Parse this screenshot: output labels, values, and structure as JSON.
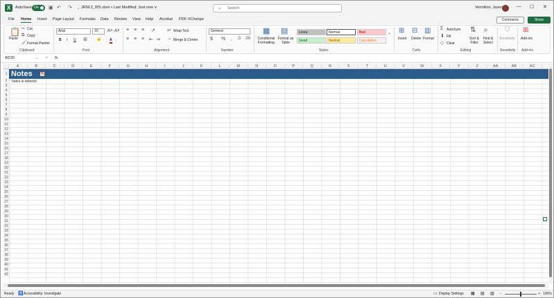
{
  "title_bar": {
    "autosave_label": "AutoSave",
    "autosave_state": "On",
    "document_title": "JRNL2_WS.xlsm • Last Modified: Just now ∨",
    "search_placeholder": "Search",
    "user_name": "Vermilion, Jason"
  },
  "menu": {
    "tabs": [
      "File",
      "Home",
      "Insert",
      "Page Layout",
      "Formulas",
      "Data",
      "Review",
      "View",
      "Help",
      "Acrobat",
      "PDF-XChange"
    ],
    "active_tab": "Home",
    "comments_label": "Comments",
    "share_label": "Share"
  },
  "ribbon": {
    "clipboard": {
      "paste": "Paste",
      "cut": "Cut",
      "copy": "Copy",
      "format_painter": "Format Painter",
      "group": "Clipboard"
    },
    "font": {
      "family": "Arial",
      "size": "10",
      "group": "Font"
    },
    "alignment": {
      "wrap_text": "Wrap Text",
      "merge_center": "Merge & Center",
      "group": "Alignment"
    },
    "number": {
      "format": "General",
      "group": "Number"
    },
    "styles": {
      "conditional_formatting": "Conditional Formatting",
      "format_as_table": "Format as Table",
      "cells": [
        {
          "label": "Linea",
          "bg": "#c0c0c0",
          "fg": "#222222"
        },
        {
          "label": "Normal",
          "bg": "#ffffff",
          "fg": "#222222"
        },
        {
          "label": "Bad",
          "bg": "#ffc7ce",
          "fg": "#9c0006"
        },
        {
          "label": "Good",
          "bg": "#c6efce",
          "fg": "#006100"
        },
        {
          "label": "Neutral",
          "bg": "#ffeb9c",
          "fg": "#9c5700"
        },
        {
          "label": "Calculation",
          "bg": "#f2f2f2",
          "fg": "#fa7d00"
        }
      ],
      "group": "Styles"
    },
    "cells": {
      "insert": "Insert",
      "delete": "Delete",
      "format": "Format",
      "group": "Cells"
    },
    "editing": {
      "autosum": "AutoSum",
      "fill": "Fill",
      "clear": "Clear",
      "sort_filter": "Sort & Filter",
      "find_select": "Find & Select",
      "group": "Editing"
    },
    "sensitivity": {
      "label": "Sensitivity",
      "group": "Sensitivity"
    },
    "addins": {
      "label": "Add-ins",
      "group": "Add-ins"
    }
  },
  "formula_bar": {
    "name_box": "AD30",
    "fx": "fx",
    "formula": ""
  },
  "sheet": {
    "columns": [
      "A",
      "B",
      "C",
      "D",
      "E",
      "F",
      "G",
      "H",
      "I",
      "J",
      "K",
      "L",
      "M",
      "N",
      "O",
      "P",
      "Q",
      "R",
      "S",
      "T",
      "U",
      "V",
      "W",
      "X",
      "Y",
      "Z",
      "AA",
      "AB",
      "AC"
    ],
    "banner_title": "Notes",
    "banner_color": "#2b5b8a",
    "cell_a2": "notes is entered",
    "row_count": 42
  },
  "status_bar": {
    "mode": "Ready",
    "accessibility": "Accessibility: Investigate",
    "display_settings": "Display Settings",
    "zoom": "100%"
  }
}
